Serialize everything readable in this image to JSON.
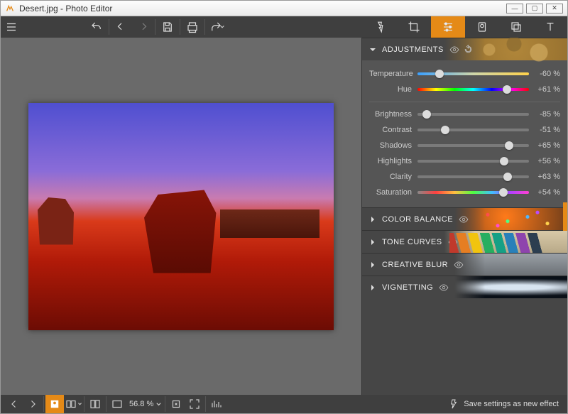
{
  "window": {
    "title": "Desert.jpg - Photo Editor"
  },
  "sections": {
    "adjustments": {
      "label": "ADJUSTMENTS"
    },
    "color_balance": {
      "label": "COLOR BALANCE"
    },
    "tone_curves": {
      "label": "TONE CURVES"
    },
    "creative_blur": {
      "label": "CREATIVE BLUR"
    },
    "vignetting": {
      "label": "VIGNETTING"
    }
  },
  "sliders": {
    "temperature": {
      "label": "Temperature",
      "value_text": "-60 %",
      "pct": 20
    },
    "hue": {
      "label": "Hue",
      "value_text": "+61 %",
      "pct": 80
    },
    "brightness": {
      "label": "Brightness",
      "value_text": "-85 %",
      "pct": 8
    },
    "contrast": {
      "label": "Contrast",
      "value_text": "-51 %",
      "pct": 25
    },
    "shadows": {
      "label": "Shadows",
      "value_text": "+65 %",
      "pct": 82
    },
    "highlights": {
      "label": "Highlights",
      "value_text": "+56 %",
      "pct": 78
    },
    "clarity": {
      "label": "Clarity",
      "value_text": "+63 %",
      "pct": 81
    },
    "saturation": {
      "label": "Saturation",
      "value_text": "+54 %",
      "pct": 77
    }
  },
  "bottom": {
    "zoom_text": "56.8 %",
    "save_effect": "Save settings as new effect"
  }
}
